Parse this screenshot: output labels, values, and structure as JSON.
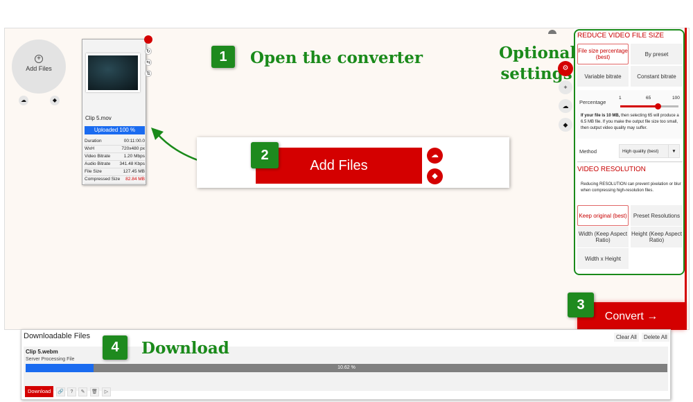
{
  "add_files_circle": {
    "label": "Add Files",
    "icon": "plus-circle-icon"
  },
  "file_card": {
    "name": "Clip 5.mov",
    "upload_status": "Uploaded 100 %",
    "upload_progress": 100,
    "rows": [
      {
        "label": "Duration",
        "value": "00:11:00.0"
      },
      {
        "label": "WxH",
        "value": "720x480 px"
      },
      {
        "label": "Video Bitrate",
        "value": "1.20 Mbps"
      },
      {
        "label": "Audio Bitrate",
        "value": "341.48 Kbps"
      },
      {
        "label": "File Size",
        "value": "127.45 MB"
      },
      {
        "label": "Compressed Size",
        "value": "82.84 MB"
      }
    ]
  },
  "steps": [
    {
      "num": "1",
      "text": "Open the converter"
    },
    {
      "num": "2",
      "text": ""
    },
    {
      "num": "3",
      "text": ""
    },
    {
      "num": "4",
      "text": "Download"
    }
  ],
  "optional_label": [
    "Optional",
    "settings"
  ],
  "add_files_button": "Add Files",
  "settings": {
    "reduce_title": "REDUCE VIDEO FILE SIZE",
    "size_options": [
      "File size percentage (best)",
      "By preset",
      "Variable bitrate",
      "Constant bitrate"
    ],
    "percentage_label": "Percentage",
    "slider_ticks": [
      "1",
      "65",
      "100"
    ],
    "slider_value": 65,
    "note_bold": "If your file is 10 MB,",
    "note_rest": " then selecting 65 will produce a 6.5 MB file. If you make the output file size too small, then output video quality may suffer.",
    "method_label": "Method",
    "method_value": "High quality (best)",
    "resolution_title": "VIDEO RESOLUTION",
    "resolution_note": "Reducing RESOLUTION can prevent pixelation or blur when compressing high-resolution files.",
    "resolution_options": [
      "Keep original (best)",
      "Preset Resolutions",
      "Width (Keep Aspect Ratio)",
      "Height (Keep Aspect Ratio)",
      "Width x Height"
    ]
  },
  "convert_button": "Convert →",
  "downloads": {
    "title": "Downloadable Files",
    "clear_all": "Clear All",
    "delete_all": "Delete All",
    "file_name": "Clip 5.webm",
    "status": "Server Processing File",
    "progress_text": "10.62 %",
    "progress": 10.62,
    "download_button": "Download"
  },
  "colors": {
    "accent": "#d40000",
    "step_green": "#1e8a1e",
    "progress_blue": "#1a6bf0"
  }
}
